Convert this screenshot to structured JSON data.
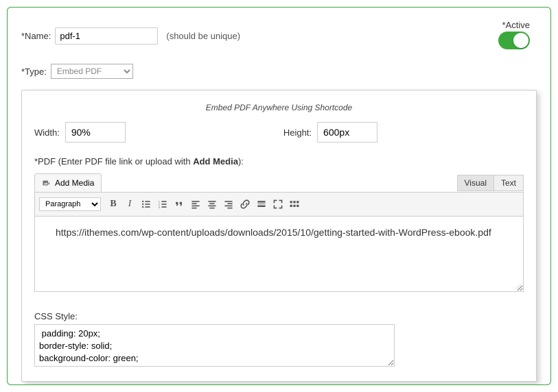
{
  "name": {
    "label": "*Name:",
    "value": "pdf-1",
    "hint": "(should be unique)"
  },
  "active": {
    "label": "*Active",
    "on": true
  },
  "type": {
    "label": "*Type:",
    "value": "Embed PDF"
  },
  "card": {
    "title": "Embed PDF Anywhere Using Shortcode",
    "width_label": "Width:",
    "width_value": "90%",
    "height_label": "Height:",
    "height_value": "600px",
    "pdf_label_prefix": "*PDF (Enter PDF file link or upload with ",
    "pdf_label_bold": "Add Media",
    "pdf_label_suffix": "):"
  },
  "editor": {
    "add_media_label": "Add Media",
    "tabs": {
      "visual": "Visual",
      "text": "Text"
    },
    "format_option": "Paragraph",
    "content": "https://ithemes.com/wp-content/uploads/downloads/2015/10/getting-started-with-WordPress-ebook.pdf"
  },
  "css": {
    "label": "CSS Style:",
    "value": " padding: 20px;\nborder-style: solid;\nbackground-color: green;"
  }
}
